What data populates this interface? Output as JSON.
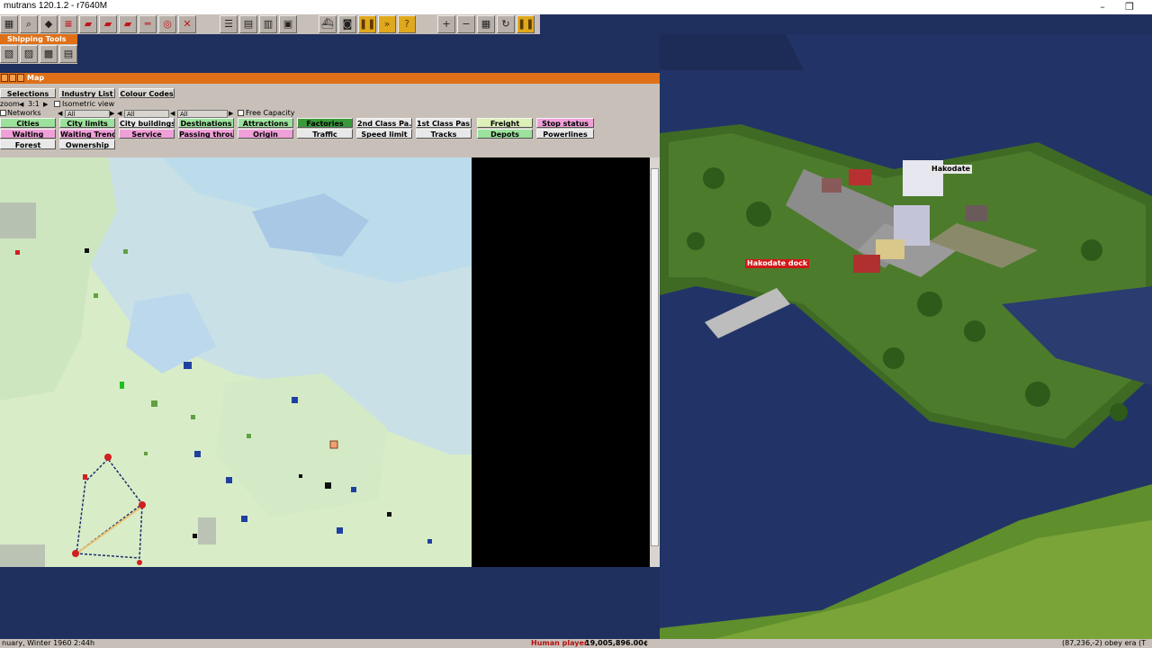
{
  "window": {
    "title": "mutrans 120.1.2 - r7640M",
    "minimize": "–",
    "restore": "❐"
  },
  "toolbar": {
    "buttons": [
      "magnify-icon",
      "terrain-icon",
      "rail-icon",
      "road-icon",
      "road-vehicle-icon",
      "tram-icon",
      "rail-line-icon",
      "depot-icon",
      "remove-icon",
      "list-icon",
      "list2-icon",
      "list3-icon",
      "ship-icon",
      "camera-icon",
      "pause-icon",
      "fast-forward-icon",
      "help-icon",
      "zoom-in-icon",
      "zoom-out-icon",
      "grid-icon",
      "arrow-icon",
      "pause2-icon"
    ]
  },
  "shipping_tools": {
    "title": "Shipping Tools"
  },
  "map_window": {
    "title": "Map",
    "selections": "Selections",
    "industry_list": "Industry List",
    "colour_codes": "Colour Codes",
    "zoom_label": "zoom",
    "zoom_value": "3:1",
    "isometric": "Isometric view",
    "free_capacity": "Free Capacity",
    "networks": "Networks",
    "combo1": "All",
    "combo2": "All",
    "filters": [
      [
        "Cities",
        "City limits",
        "City buildings",
        "Destinations",
        "Attractions",
        "Factories",
        "2nd Class Pa...",
        "1st Class Pas...",
        "Freight",
        "Stop status"
      ],
      [
        "Waiting",
        "Waiting Trend",
        "Service",
        "Passing throu...",
        "Origin",
        "Traffic",
        "Speed limit",
        "Tracks",
        "Depots",
        "Powerlines"
      ],
      [
        "Forest",
        "Ownership"
      ]
    ]
  },
  "world": {
    "city_name": "Hakodate",
    "dock_name": "Hakodate dock"
  },
  "status": {
    "date": "nuary, Winter 1960  2:44h",
    "player": "Human player",
    "money": "19,005,896.00¢",
    "coords": "(87,236,-2) obey era (T"
  },
  "colors": {
    "title_orange": "#e07018",
    "panel": "#c8c0b8",
    "water": "#1f2f5e"
  }
}
